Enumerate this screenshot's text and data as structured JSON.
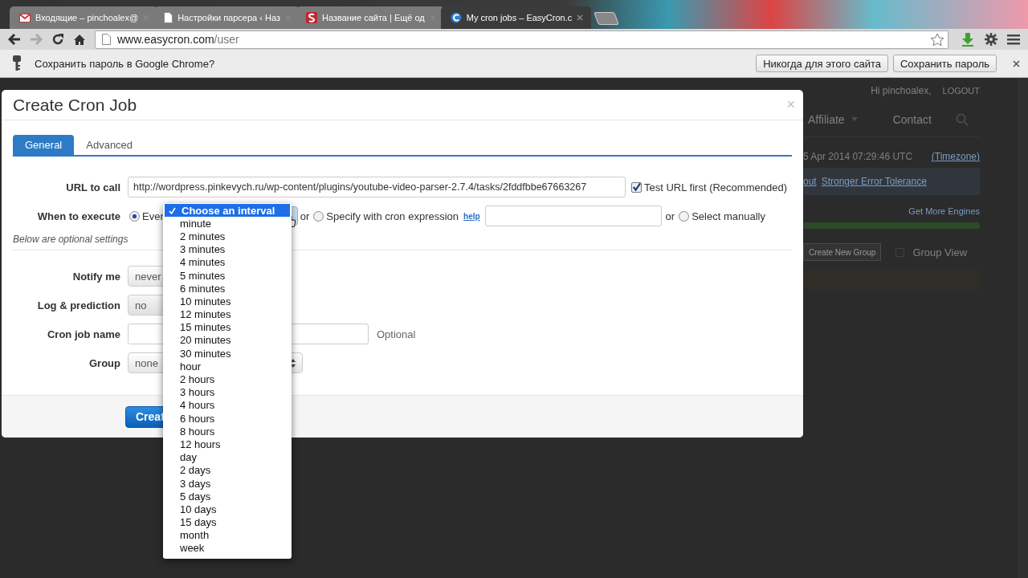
{
  "browser": {
    "tabs": [
      {
        "title": "Входящие – pinchoalex@",
        "selected": false
      },
      {
        "title": "Настройки парсера ‹ Наз",
        "selected": false
      },
      {
        "title": "Название сайта | Ещё од",
        "selected": false
      },
      {
        "title": "My cron jobs – EasyCron.c",
        "selected": true
      }
    ],
    "address": {
      "host": "www.easycron.com",
      "path": "/user"
    },
    "infobar": {
      "text": "Сохранить пароль в Google Chrome?",
      "buttons": [
        "Никогда для этого сайта",
        "Сохранить пароль"
      ]
    }
  },
  "background_page": {
    "greeting": "Hi pinchoalex,",
    "logout": "LOGOUT",
    "nav": [
      "Affiliate",
      "Contact"
    ],
    "time": "5 Apr 2014 07:29:46 UTC",
    "timezone": "(Timezone)",
    "notice_links": [
      "out",
      "Stronger Error Tolerance"
    ],
    "engines_link": "Get More Engines",
    "engines_bar": {
      "level": 1
    },
    "create_group": "Create New Group",
    "group_view": {
      "label": "Group View",
      "checked": false
    }
  },
  "modal": {
    "title": "Create Cron Job",
    "close": "×",
    "tabs": [
      {
        "label": "General",
        "selected": true
      },
      {
        "label": "Advanced",
        "selected": false
      }
    ],
    "url_row": {
      "label": "URL to call",
      "value": "http://wordpress.pinkevych.ru/wp-content/plugins/youtube-video-parser-2.7.4/tasks/2fddfbbe67663267",
      "test_first": {
        "label": "Test URL first (Recommended)",
        "checked": true
      }
    },
    "when_row": {
      "label": "When to execute",
      "every": {
        "label": "Ever",
        "selected": true
      },
      "or_1": "or",
      "cron": {
        "label": "Specify with cron expression",
        "selected": false
      },
      "help": "help",
      "or_2": "or",
      "manual": {
        "label": "Select manually",
        "selected": false
      }
    },
    "optional_note": "Below are optional settings",
    "notify_row": {
      "label": "Notify me",
      "value": "never"
    },
    "log_row": {
      "label": "Log & prediction",
      "value": "no"
    },
    "name_row": {
      "label": "Cron job name",
      "hint": "Optional"
    },
    "group_row": {
      "label": "Group",
      "value": "none"
    },
    "create_button": "Creat"
  },
  "interval_menu": [
    {
      "label": "Choose an interval",
      "selected": true
    },
    {
      "label": "minute",
      "selected": false
    },
    {
      "label": "2 minutes",
      "selected": false
    },
    {
      "label": "3 minutes",
      "selected": false
    },
    {
      "label": "4 minutes",
      "selected": false
    },
    {
      "label": "5 minutes",
      "selected": false
    },
    {
      "label": "6 minutes",
      "selected": false
    },
    {
      "label": "10 minutes",
      "selected": false
    },
    {
      "label": "12 minutes",
      "selected": false
    },
    {
      "label": "15 minutes",
      "selected": false
    },
    {
      "label": "20 minutes",
      "selected": false
    },
    {
      "label": "30 minutes",
      "selected": false
    },
    {
      "label": "hour",
      "selected": false
    },
    {
      "label": "2 hours",
      "selected": false
    },
    {
      "label": "3 hours",
      "selected": false
    },
    {
      "label": "4 hours",
      "selected": false
    },
    {
      "label": "6 hours",
      "selected": false
    },
    {
      "label": "8 hours",
      "selected": false
    },
    {
      "label": "12 hours",
      "selected": false
    },
    {
      "label": "day",
      "selected": false
    },
    {
      "label": "2 days",
      "selected": false
    },
    {
      "label": "3 days",
      "selected": false
    },
    {
      "label": "5 days",
      "selected": false
    },
    {
      "label": "10 days",
      "selected": false
    },
    {
      "label": "15 days",
      "selected": false
    },
    {
      "label": "month",
      "selected": false
    },
    {
      "label": "week",
      "selected": false
    }
  ]
}
